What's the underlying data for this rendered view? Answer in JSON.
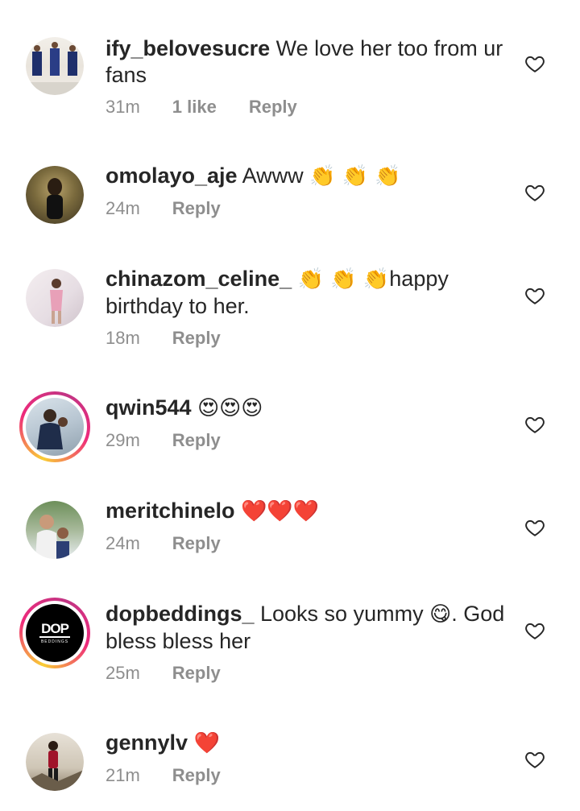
{
  "comments": [
    {
      "username": "ify_belovesucre",
      "text": " We love her too from ur fans",
      "emoji": "",
      "text_after": "",
      "time": "31m",
      "likes": "1 like",
      "reply": "Reply"
    },
    {
      "username": "omolayo_aje",
      "text": " Awww ",
      "emoji": "👏 👏 👏",
      "text_after": "",
      "time": "24m",
      "likes": "",
      "reply": "Reply"
    },
    {
      "username": "chinazom_celine_",
      "text": " ",
      "emoji": "👏 👏 👏",
      "text_after": "happy birthday to her.",
      "time": "18m",
      "likes": "",
      "reply": "Reply"
    },
    {
      "username": "qwin544",
      "text": " ",
      "emoji": "😍😍😍",
      "text_after": "",
      "time": "29m",
      "likes": "",
      "reply": "Reply"
    },
    {
      "username": "meritchinelo",
      "text": " ",
      "emoji": "❤️❤️❤️",
      "text_after": "",
      "time": "24m",
      "likes": "",
      "reply": "Reply"
    },
    {
      "username": "dopbeddings_",
      "text": " Looks so yummy ",
      "emoji": "😋",
      "text_after": ". God bless bless her",
      "time": "25m",
      "likes": "",
      "reply": "Reply"
    },
    {
      "username": "gennylv",
      "text": " ",
      "emoji": "❤️",
      "text_after": "",
      "time": "21m",
      "likes": "",
      "reply": "Reply"
    }
  ],
  "dop_logo": {
    "brand": "DOP",
    "sub": "BEDDINGS"
  },
  "colors": {
    "meta": "#8e8e8e",
    "text": "#262626",
    "story_ring": "#ee2a7b"
  }
}
